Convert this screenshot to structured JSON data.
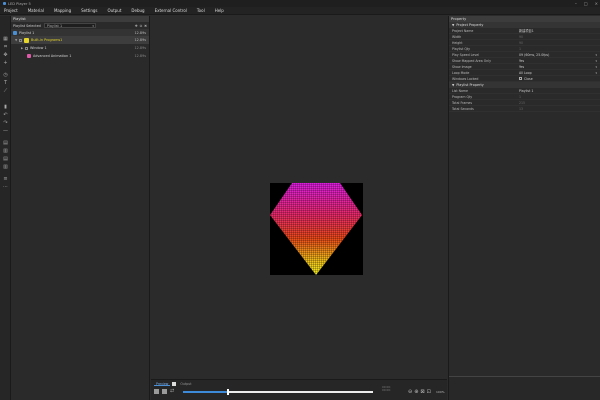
{
  "window": {
    "title": "LED Player 5"
  },
  "menu": [
    "Project",
    "Material",
    "Mapping",
    "Settings",
    "Output",
    "Debug",
    "External Control",
    "Tool",
    "Help"
  ],
  "playlist_panel": {
    "header": "Playlist",
    "selected_label": "Playlist Selected",
    "selected_value": "Playlist 1",
    "root": {
      "label": "Playlist 1",
      "duration": "12.89s"
    },
    "items": [
      {
        "label": "Built-in Programs1",
        "duration": "12.89s",
        "level": 1,
        "color": "#e6d52a"
      },
      {
        "label": "Window 1",
        "duration": "12.89s",
        "level": 2,
        "color": "#888888"
      },
      {
        "label": "Advanced Animation 1",
        "duration": "12.89s",
        "level": 3,
        "color": "#e05aa8"
      }
    ]
  },
  "bottom": {
    "tabs": [
      "Preview",
      "Output"
    ],
    "progress": 0.23,
    "timecode_line1": "00:00:",
    "timecode_line2": "00:00:",
    "zoom": "100%"
  },
  "properties": {
    "header": "Property",
    "project_section": "Project Property",
    "project_rows": [
      {
        "key": "Project Name",
        "value": "新建项目1",
        "dim": false
      },
      {
        "key": "Width",
        "value": "90",
        "dim": true
      },
      {
        "key": "Height",
        "value": "90",
        "dim": true
      },
      {
        "key": "Playlist Qty",
        "value": "1",
        "dim": true
      },
      {
        "key": "Play Speed Level",
        "value": "09 (60ms, 25.0fps)",
        "dim": false,
        "dropdown": true
      },
      {
        "key": "Show Mapped Area Only",
        "value": "Yes",
        "dim": false,
        "dropdown": true
      },
      {
        "key": "Show Image",
        "value": "Yes",
        "dim": false,
        "dropdown": true
      },
      {
        "key": "Loop Mode",
        "value": "All Loop",
        "dim": false,
        "dropdown": true
      },
      {
        "key": "Windows Locked",
        "value": "Close",
        "dim": false,
        "checkbox": true
      }
    ],
    "playlist_section": "Playlist Property",
    "playlist_rows": [
      {
        "key": "List Name",
        "value": "Playlist 1",
        "dim": false
      },
      {
        "key": "Program Qty",
        "value": "1",
        "dim": true
      },
      {
        "key": "Total Frames",
        "value": "215",
        "dim": true
      },
      {
        "key": "Total Seconds",
        "value": "13",
        "dim": true
      }
    ]
  }
}
